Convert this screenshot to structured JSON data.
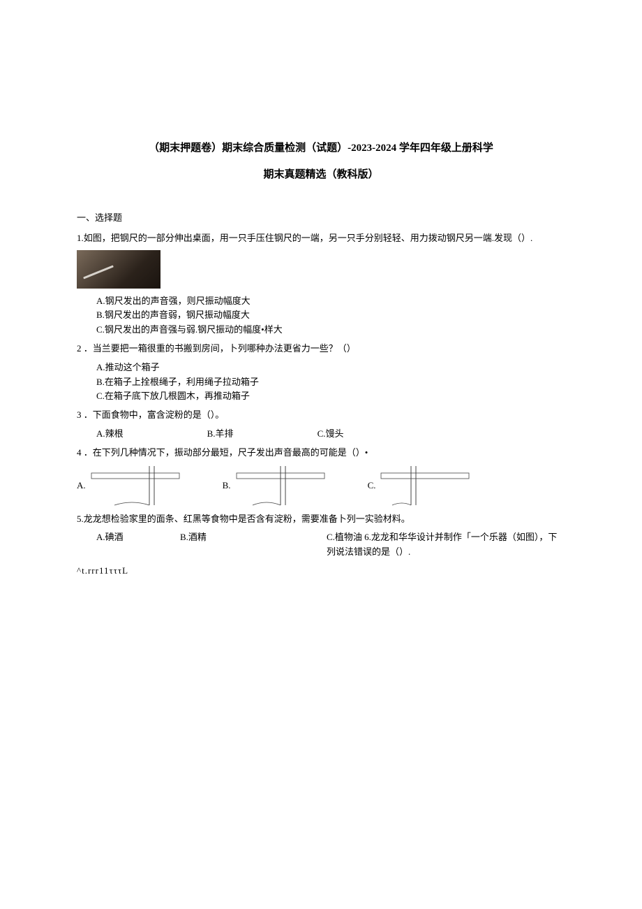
{
  "title": "（期末押题卷）期末综合质量检测（试题）-2023-2024 学年四年级上册科学",
  "subtitle": "期末真题精选（教科版）",
  "section1": "一、选择题",
  "q1": {
    "num": "1.",
    "stem": "如图，把钢尺的一部分伸出桌面，用一只手压住钢尺的一端，另一只手分别轻轻、用力拨动钢尺另一端.发现（）.",
    "A": "A.钢尺发出的声音强，则尺振动幅度大",
    "B": "B.钢尺发出的声音弱，钢尺振动幅度大",
    "C": "C.钢尺发出的声音强与弱.钢尺振动的幅度•样大"
  },
  "q2": {
    "num": "2",
    "stem": "．当兰要把一箱很重的书搬到房间，卜列哪种办法更省力一些？（）",
    "A": "A.推动这个箱子",
    "B": "B.在箱子上拴根绳子，利用绳子拉动箱子",
    "C": "C.在箱子底下放几根圆木，再推动箱子"
  },
  "q3": {
    "num": "3",
    "stem": "．下面食物中，富含淀粉的是（）。",
    "A": "A.辣根",
    "B": "B.羊排",
    "C": "C.馒头"
  },
  "q4": {
    "num": "4",
    "stem": "．在下列几种情况下，振动部分最短，尺子发出声音最高的可能是（）•",
    "labels": {
      "A": "A.",
      "B": "B.",
      "C": "C."
    }
  },
  "q5": {
    "num": "5.",
    "stem": "龙龙想检验家里的面条、红黑等食物中是否含有淀粉，需要准备卜列一实验材料。",
    "A": "A.碘酒",
    "B": "B.酒精",
    "C": "C.植物油"
  },
  "q6": {
    "stem": "6.龙龙和华华设计并制作「一个乐器（如图），下列说法错误的是（）.",
    "gib": "^t.rrr11τττL"
  }
}
